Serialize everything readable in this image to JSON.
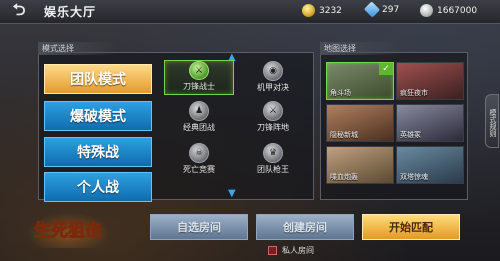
{
  "header": {
    "title": "娱乐大厅",
    "back_icon": "back-arrow-icon",
    "currencies": [
      {
        "icon": "gold-coin-icon",
        "value": "3232"
      },
      {
        "icon": "diamond-icon",
        "value": "297"
      },
      {
        "icon": "silver-coin-icon",
        "value": "1667000"
      }
    ]
  },
  "mode_panel": {
    "label": "模式选择",
    "modes": [
      {
        "label": "团队模式",
        "active": true
      },
      {
        "label": "爆破模式",
        "active": false
      },
      {
        "label": "特殊战",
        "active": false
      },
      {
        "label": "个人战",
        "active": false
      }
    ],
    "submodes": [
      {
        "label": "刀锋战士",
        "icon": "crossed-swords-icon",
        "selected": true
      },
      {
        "label": "机甲对决",
        "icon": "mech-helmet-icon",
        "selected": false
      },
      {
        "label": "经典团战",
        "icon": "team-icon",
        "selected": false
      },
      {
        "label": "刀锋阵地",
        "icon": "blade-base-icon",
        "selected": false
      },
      {
        "label": "死亡竞赛",
        "icon": "skull-icon",
        "selected": false
      },
      {
        "label": "团队枪王",
        "icon": "crown-icon",
        "selected": false
      }
    ]
  },
  "map_panel": {
    "label": "地图选择",
    "side_tab": "模式规则",
    "maps": [
      {
        "name": "角斗场",
        "selected": true,
        "color": "#4a5a3a"
      },
      {
        "name": "疯狂夜市",
        "selected": false,
        "color": "#6a3a3a"
      },
      {
        "name": "隐秘新城",
        "selected": false,
        "color": "#5a4a3a"
      },
      {
        "name": "英雄冢",
        "selected": false,
        "color": "#4a4a5a"
      },
      {
        "name": "喋血炮轰",
        "selected": false,
        "color": "#6a5a4a"
      },
      {
        "name": "双塔惊魂",
        "selected": false,
        "color": "#3a4a5a"
      }
    ]
  },
  "actions": {
    "custom_room": "自选房间",
    "create_room": "创建房间",
    "start_match": "开始匹配",
    "private_room": "私人房间"
  },
  "logo_text": "生死狙击"
}
